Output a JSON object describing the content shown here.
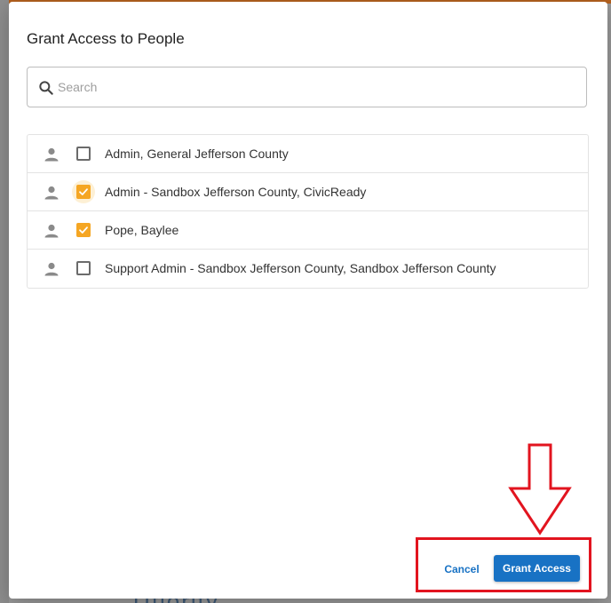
{
  "background": {
    "peek_text": "Ufiority"
  },
  "dialog": {
    "title": "Grant Access to People"
  },
  "search": {
    "icon": "search-icon",
    "placeholder": "Search",
    "value": ""
  },
  "people": [
    {
      "name": "Admin, General Jefferson County",
      "checked": false,
      "focused": false,
      "icon": "person-icon"
    },
    {
      "name": "Admin - Sandbox Jefferson County, CivicReady",
      "checked": true,
      "focused": true,
      "icon": "person-icon"
    },
    {
      "name": "Pope, Baylee",
      "checked": true,
      "focused": false,
      "icon": "person-icon"
    },
    {
      "name": "Support Admin - Sandbox Jefferson County, Sandbox Jefferson County",
      "checked": false,
      "focused": false,
      "icon": "person-icon"
    }
  ],
  "actions": {
    "cancel_label": "Cancel",
    "grant_label": "Grant Access"
  },
  "colors": {
    "accent_blue": "#1872c4",
    "checkbox_checked": "#f5a623",
    "annotation_red": "#e2141f"
  },
  "annotation": {
    "type": "arrow-down",
    "target": "grant-access-button"
  }
}
